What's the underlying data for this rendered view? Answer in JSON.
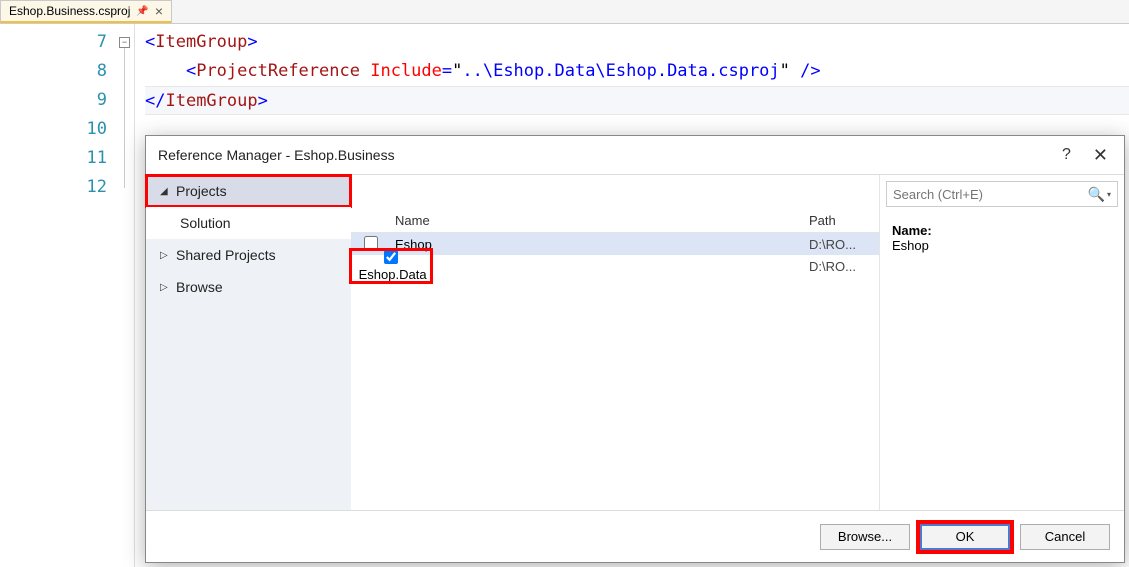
{
  "tab": {
    "filename": "Eshop.Business.csproj"
  },
  "editor": {
    "lines": [
      "7",
      "8",
      "9",
      "10",
      "11",
      "12"
    ],
    "code": {
      "l7_open": "<",
      "l7_tag": "ItemGroup",
      "l7_close": ">",
      "l8_indent": "    ",
      "l8_open": "<",
      "l8_tag": "ProjectReference",
      "l8_space": " ",
      "l8_attr": "Include",
      "l8_eq": "=",
      "l8_q1": "\"",
      "l8_val": "..\\Eshop.Data\\Eshop.Data.csproj",
      "l8_q2": "\"",
      "l8_end": " />",
      "l9_open": "</",
      "l9_tag": "ItemGroup",
      "l9_close": ">"
    }
  },
  "dialog": {
    "title": "Reference Manager - Eshop.Business",
    "nav": {
      "projects": "Projects",
      "solution": "Solution",
      "shared": "Shared Projects",
      "browse": "Browse"
    },
    "search": {
      "placeholder": "Search (Ctrl+E)"
    },
    "columns": {
      "name": "Name",
      "path": "Path"
    },
    "rows": [
      {
        "name": "Eshop",
        "path": "D:\\RO...",
        "checked": false,
        "selected": true
      },
      {
        "name": "Eshop.Data",
        "path": "D:\\RO...",
        "checked": true,
        "selected": false
      }
    ],
    "detail": {
      "label": "Name:",
      "value": "Eshop"
    },
    "buttons": {
      "browse": "Browse...",
      "ok": "OK",
      "cancel": "Cancel"
    }
  }
}
